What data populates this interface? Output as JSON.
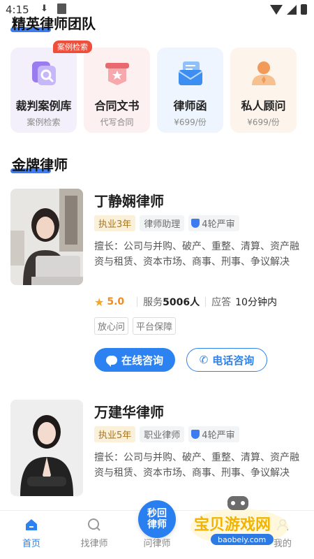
{
  "status_bar": {
    "time": "4:15"
  },
  "elite_section": {
    "title": "精英律师团队"
  },
  "services": [
    {
      "name": "裁判案例库",
      "sub": "案例检索",
      "badge": "案例检索",
      "icon": "case-library-icon"
    },
    {
      "name": "合同文书",
      "sub": "代写合同",
      "icon": "contract-icon"
    },
    {
      "name": "律师函",
      "sub": "¥699/份",
      "icon": "lawyer-letter-icon"
    },
    {
      "name": "私人顾问",
      "sub": "¥699/份",
      "icon": "advisor-icon"
    }
  ],
  "gold_section": {
    "title": "金牌律师"
  },
  "lawyers": [
    {
      "name": "丁静娴律师",
      "years": "执业3年",
      "role": "律师助理",
      "review": "4轮严审",
      "desc": "擅长：公司与并购、破产、重整、清算、资产融资与租赁、资本市场、商事、刑事、争议解决",
      "rating": "5.0",
      "service_label": "服务",
      "service_count": "5006人",
      "response_label": "应答",
      "response_time": "10分钟内",
      "ptags": [
        "放心问",
        "平台保障"
      ],
      "btn_online": "在线咨询",
      "btn_phone": "电话咨询"
    },
    {
      "name": "万建华律师",
      "years": "执业5年",
      "role": "职业律师",
      "review": "4轮严审",
      "desc": "擅长：公司与并购、破产、重整、清算、资产融资与租赁、资本市场、商事、刑事、争议解决"
    }
  ],
  "tabbar": {
    "home": "首页",
    "find": "找律师",
    "ask": "问律师",
    "center_line1": "秒回",
    "center_line2": "律师",
    "mine": "我的"
  },
  "watermark": {
    "line1": "宝贝游戏网",
    "line2": "baobeiy.com"
  },
  "colors": {
    "accent": "#2c82f0",
    "badge": "#ef4e3a",
    "gold_tag": "#fbf0d9",
    "star": "#f5a623"
  }
}
